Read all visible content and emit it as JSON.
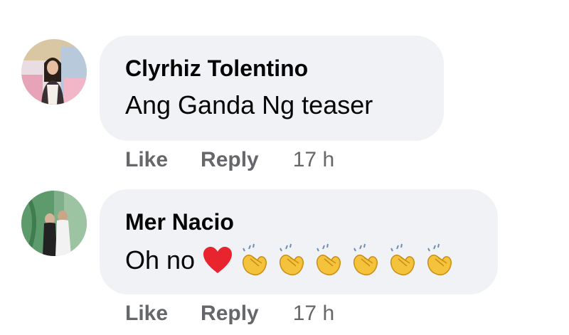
{
  "comments": [
    {
      "author": "Clyrhiz Tolentino",
      "text": "Ang Ganda Ng teaser",
      "actions": {
        "like": "Like",
        "reply": "Reply",
        "time": "17 h"
      }
    },
    {
      "author": "Mer Nacio",
      "text": "Oh no",
      "emojis": [
        "red-heart-icon",
        "clapping-hands-icon",
        "clapping-hands-icon",
        "clapping-hands-icon",
        "clapping-hands-icon",
        "clapping-hands-icon",
        "clapping-hands-icon"
      ],
      "actions": {
        "like": "Like",
        "reply": "Reply",
        "time": "17 h"
      }
    }
  ],
  "colors": {
    "bubble_bg": "#f0f2f5",
    "author_text": "#050505",
    "meta_text": "#65676b",
    "heart": "#e8242f",
    "clap": "#f5c33b"
  }
}
